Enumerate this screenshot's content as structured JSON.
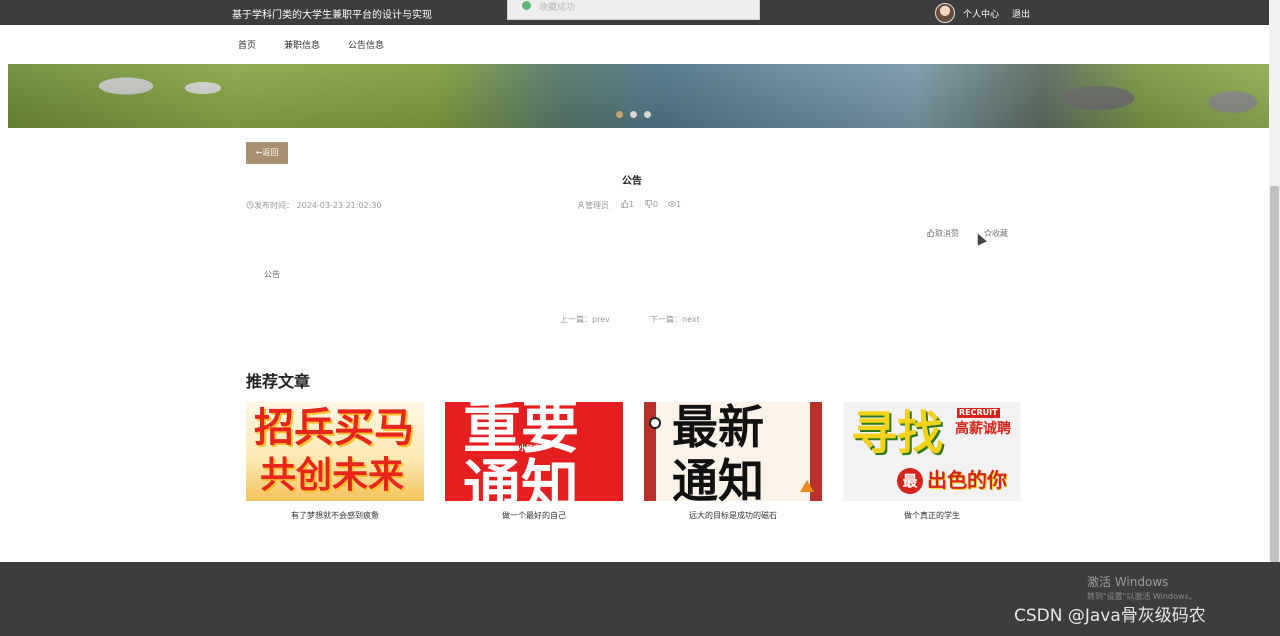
{
  "topbar": {
    "site_title": "基于学科门类的大学生兼职平台的设计与实现",
    "toast_text": "收藏成功",
    "user_center": "个人中心",
    "logout": "退出"
  },
  "nav": {
    "items": [
      {
        "label": "首页"
      },
      {
        "label": "兼职信息"
      },
      {
        "label": "公告信息"
      }
    ]
  },
  "carousel": {
    "dots": 3,
    "active_index": 0
  },
  "detail": {
    "back_label": "←返回",
    "title": "公告",
    "publish_time_label": "发布时间：",
    "publish_time": "2024-03-23 21:02:30",
    "author": "管理员",
    "likes": "1",
    "dislikes": "0",
    "views": "1",
    "unlike_label": "取消赞",
    "favorite_label": "收藏",
    "content": "公告",
    "prev_label": "上一篇：prev",
    "next_label": "下一篇：next"
  },
  "recommend": {
    "section_title": "推荐文章",
    "cards": [
      {
        "caption": "有了梦想就不会感到疲惫",
        "image_text_top": "招兵买马",
        "image_text_bottom": "共创未来"
      },
      {
        "caption": "做一个最好的自己",
        "image_text_top": "重要",
        "image_text_bottom": "通知",
        "image_small": "小红书"
      },
      {
        "caption": "远大的目标是成功的磁石",
        "image_text_top": "最新",
        "image_text_bottom": "通知"
      },
      {
        "caption": "做个真正的学生",
        "image_text_top": "寻找",
        "image_text_bottom": "出色的你",
        "image_badge": "最",
        "image_tag": "高薪诚聘",
        "image_tag_en": "RECRUIT"
      }
    ]
  },
  "watermarks": {
    "windows_title": "激活 Windows",
    "windows_sub": "转到\"设置\"以激活 Windows。",
    "csdn": "CSDN @Java骨灰级码农"
  },
  "colors": {
    "topbar_bg": "#3d3d3d",
    "accent": "#a89070",
    "footer_bg": "#3d3d3d"
  }
}
